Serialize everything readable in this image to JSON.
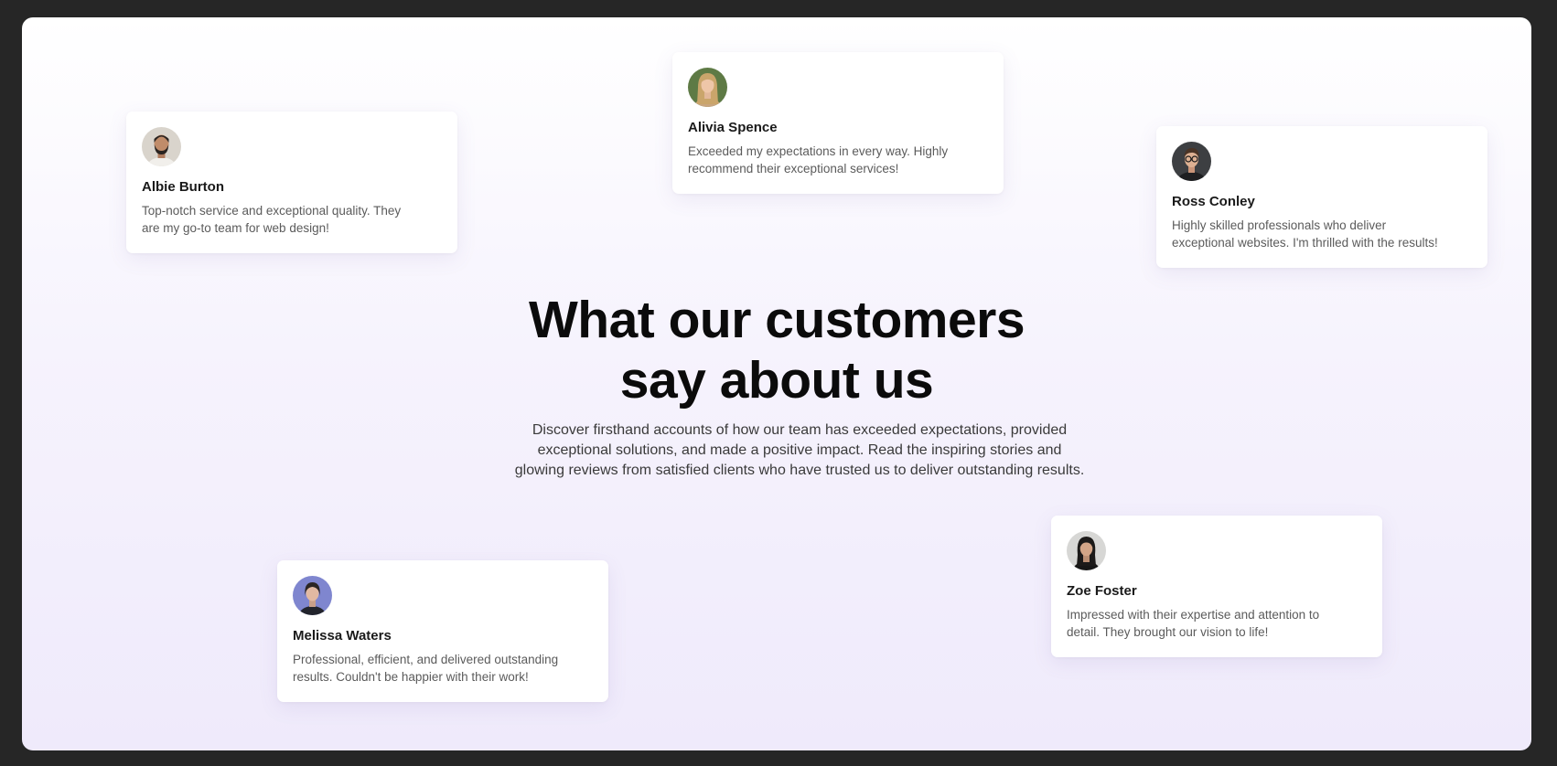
{
  "section": {
    "heading_line1": "What our customers",
    "heading_line2": "say about us",
    "intro_line1": "Discover firsthand accounts of how our team has exceeded expectations, provided",
    "intro_line2": "exceptional solutions, and made a positive impact. Read the inspiring stories and",
    "intro_line3": "glowing reviews from satisfied clients who have trusted us to deliver outstanding results."
  },
  "testimonials": [
    {
      "name": "Albie Burton",
      "quote_line1": "Top-notch service and exceptional quality. They",
      "quote_line2": "are my go-to team for web design!",
      "avatar_icon": "man-with-beard-avatar"
    },
    {
      "name": "Alivia Spence",
      "quote_line1": "Exceeded my expectations in every way. Highly",
      "quote_line2": "recommend their exceptional services!",
      "avatar_icon": "blonde-woman-avatar"
    },
    {
      "name": "Ross Conley",
      "quote_line1": "Highly skilled professionals who deliver",
      "quote_line2": "exceptional websites. I'm thrilled with the results!",
      "avatar_icon": "man-with-glasses-avatar"
    },
    {
      "name": "Melissa Waters",
      "quote_line1": "Professional, efficient, and delivered outstanding",
      "quote_line2": "results. Couldn't be happier with their work!",
      "avatar_icon": "woman-blue-background-avatar"
    },
    {
      "name": "Zoe Foster",
      "quote_line1": "Impressed with their expertise and attention to",
      "quote_line2": "detail. They brought our vision to life!",
      "avatar_icon": "woman-dark-hair-avatar"
    }
  ],
  "colors": {
    "page_background": "#262626",
    "section_background_top": "#ffffff",
    "section_background_bottom": "#efeafb",
    "heading": "#0b0b0b",
    "body_text": "#3a3a3a",
    "card_background": "#ffffff",
    "quote_text": "#5b5b5b"
  }
}
